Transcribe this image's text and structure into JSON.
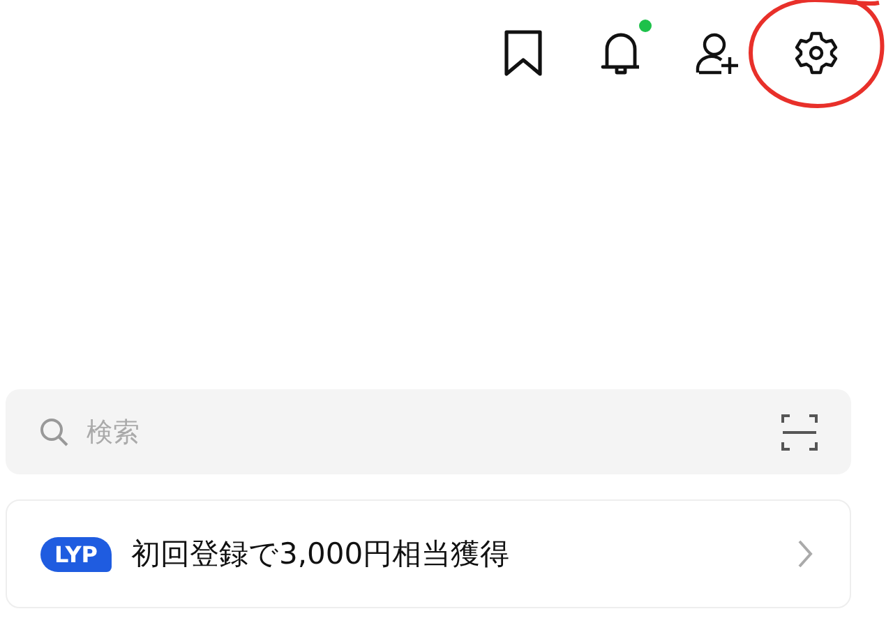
{
  "header_icons": [
    {
      "kind": "bookmark",
      "badge": false,
      "circled": false
    },
    {
      "kind": "bell",
      "badge": true,
      "circled": false
    },
    {
      "kind": "add-friend",
      "badge": false,
      "circled": false
    },
    {
      "kind": "settings",
      "badge": false,
      "circled": true
    }
  ],
  "search": {
    "placeholder": "検索"
  },
  "promo": {
    "logo": "LYP",
    "text": "初回登録で3,000円相当獲得"
  }
}
